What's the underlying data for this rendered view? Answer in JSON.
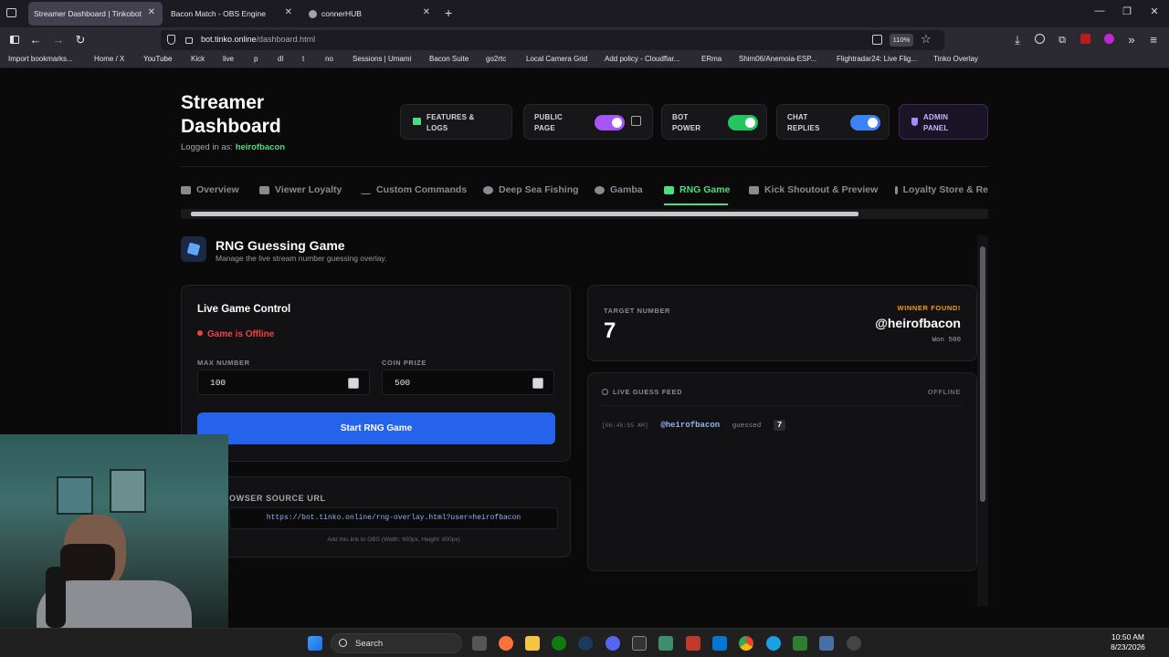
{
  "browser": {
    "tabs": [
      {
        "title": "Streamer Dashboard | Tinkobot",
        "active": true
      },
      {
        "title": "Bacon Match - OBS Engine",
        "active": false
      },
      {
        "title": "connerHUB",
        "active": false
      }
    ],
    "new_tab": "+",
    "url": {
      "host": "bot.tinko.online",
      "path": "/dashboard.html"
    },
    "zoom": "110%",
    "bookmarks": [
      "Import bookmarks...",
      "Home / X",
      "YouTube",
      "Kick",
      "live",
      "p",
      "dl",
      "t",
      "no",
      "Sessions | Umami",
      "Bacon Suite",
      "go2rtc",
      "Local Camera Grid",
      "Add policy - Cloudflar...",
      "ERma",
      "Shim06/Anemoia-ESP...",
      "Flightradar24: Live Flig...",
      "Tinko Overlay"
    ]
  },
  "header": {
    "title_line1": "Streamer",
    "title_line2": "Dashboard",
    "logged_in_label": "Logged in as:",
    "username": "heirofbacon",
    "features_button": {
      "line1": "FEATURES &",
      "line2": "LOGS"
    },
    "public_page": {
      "line1": "PUBLIC",
      "line2": "PAGE",
      "on": true,
      "color": "#a855f7"
    },
    "bot_power": {
      "line1": "BOT",
      "line2": "POWER",
      "on": true,
      "color": "#22c55e"
    },
    "chat_replies": {
      "line1": "CHAT",
      "line2": "REPLIES",
      "on": true,
      "color": "#3b82f6"
    },
    "admin_panel": {
      "line1": "ADMIN",
      "line2": "PANEL"
    }
  },
  "nav_tabs": [
    {
      "label": "Overview",
      "active": false
    },
    {
      "label": "Viewer Loyalty",
      "active": false
    },
    {
      "label": "Custom Commands",
      "active": false
    },
    {
      "label": "Deep Sea Fishing",
      "active": false
    },
    {
      "label": "Gamba",
      "active": false
    },
    {
      "label": "RNG Game",
      "active": true
    },
    {
      "label": "Kick Shoutout & Preview",
      "active": false
    },
    {
      "label": "Loyalty Store & Re",
      "active": false
    }
  ],
  "section": {
    "title": "RNG Guessing Game",
    "subtitle": "Manage the live stream number guessing overlay."
  },
  "live_control": {
    "title": "Live Game Control",
    "status": "Game is Offline",
    "max_label": "MAX NUMBER",
    "max_value": "100",
    "prize_label": "COIN PRIZE",
    "prize_value": "500",
    "start_button": "Start RNG Game"
  },
  "browser_source": {
    "title": "OWSER SOURCE URL",
    "url": "https://bot.tinko.online/rng-overlay.html?user=heirofbacon",
    "hint": "Add this link to OBS (Width: 600px, Height: 800px)"
  },
  "target": {
    "label": "TARGET NUMBER",
    "value": "7",
    "winner_label": "WINNER FOUND!",
    "winner_name": "@heirofbacon",
    "won_text": "Won 500"
  },
  "feed": {
    "title": "LIVE GUESS FEED",
    "status": "OFFLINE",
    "entries": [
      {
        "time": "[06:45:55 AM]",
        "user": "@heirofbacon",
        "verb": "guessed",
        "value": "7"
      }
    ]
  },
  "taskbar": {
    "search": "Search",
    "time": "10:50 AM",
    "date": "8/23/2026"
  },
  "colors": {
    "accent_green": "#4ade80",
    "offline_red": "#ef4444",
    "start_blue": "#2563eb",
    "winner_gold": "#f59e0b"
  }
}
